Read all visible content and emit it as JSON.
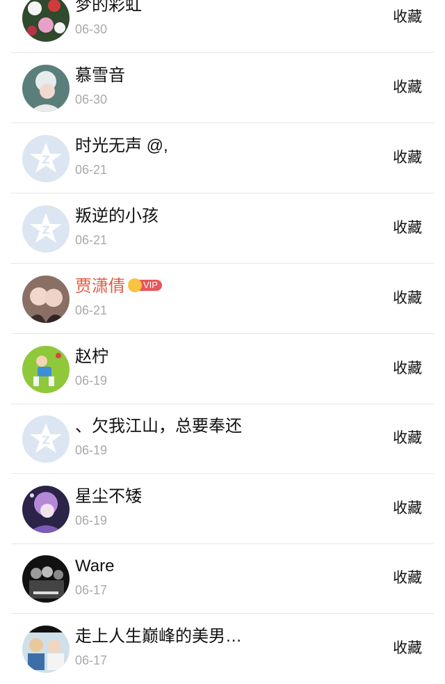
{
  "action_label": "收藏",
  "vip_label": "VIP",
  "colors": {
    "vip_name": "#e15b3f",
    "date_gray": "#a9a9a9",
    "vip_pill": "#e8565a",
    "crown": "#f7c340",
    "default_avatar": "#dce6f2"
  },
  "items": [
    {
      "name": "梦的彩虹",
      "date": "06-30",
      "avatar": "flowers-photo"
    },
    {
      "name": "慕雪音",
      "date": "06-30",
      "avatar": "person-photo"
    },
    {
      "name": "时光无声 @,",
      "date": "06-21",
      "avatar": "default-qq-avatar"
    },
    {
      "name": "叛逆的小孩",
      "date": "06-21",
      "avatar": "default-qq-avatar"
    },
    {
      "name": "贾潇倩",
      "date": "06-21",
      "avatar": "two-girls-photo",
      "vip": true
    },
    {
      "name": "赵柠",
      "date": "06-19",
      "avatar": "cartoon-boy-on-grass"
    },
    {
      "name": "、欠我江山，总要奉还",
      "date": "06-19",
      "avatar": "default-qq-avatar"
    },
    {
      "name": "星尘不矮",
      "date": "06-19",
      "avatar": "purple-anime-girl"
    },
    {
      "name": "Ware",
      "date": "06-17",
      "avatar": "black-white-group-photo"
    },
    {
      "name": "走上人生巅峰的美男…",
      "date": "06-17",
      "avatar": "group-selfie-photo"
    }
  ]
}
